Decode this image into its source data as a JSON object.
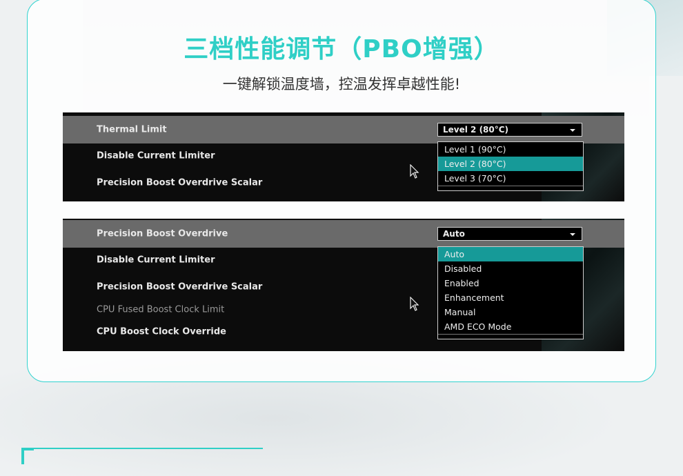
{
  "header": {
    "title": "三档性能调节（PBO增强）",
    "subtitle": "一键解锁温度墙，控温发挥卓越性能!"
  },
  "panel1": {
    "rows": [
      {
        "label": "Thermal Limit"
      },
      {
        "label": "Disable Current Limiter"
      },
      {
        "label": "Precision Boost Overdrive Scalar"
      }
    ],
    "select_value": "Level 2 (80°C)",
    "options": [
      "Level 1 (90°C)",
      "Level 2 (80°C)",
      "Level 3 (70°C)"
    ],
    "selected_option_index": 1
  },
  "panel2": {
    "rows": [
      {
        "label": "Precision Boost Overdrive"
      },
      {
        "label": "Disable Current Limiter"
      },
      {
        "label": "Precision Boost Overdrive Scalar"
      },
      {
        "label": "CPU Fused Boost Clock Limit"
      },
      {
        "label": "CPU Boost Clock Override"
      }
    ],
    "select_value": "Auto",
    "options": [
      "Auto",
      "Disabled",
      "Enabled",
      "Enhancement",
      "Manual",
      "AMD ECO Mode"
    ],
    "selected_option_index": 0
  },
  "colors": {
    "accent": "#2fcfc6",
    "highlight": "#169a98",
    "selected_row": "#6a6a6a",
    "panel_bg": "#0c0c0c"
  }
}
